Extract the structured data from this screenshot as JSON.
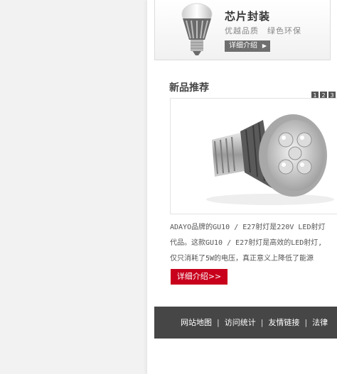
{
  "banner": {
    "title": "芯片封装",
    "subtitle": "优越品质　绿色环保",
    "button_label": "详细介绍",
    "button_arrow": "▶"
  },
  "section": {
    "title": "新品推荐",
    "pages": [
      "1",
      "2",
      "3"
    ]
  },
  "product": {
    "description_lines": [
      "ADAYO品牌的GU10 / E27射灯是220V LED射灯",
      "代品。这款GU10 / E27射灯是高效的LED射灯,",
      "仅只消耗了5W的电压，真正意义上降低了能源"
    ],
    "more_label": "详细介绍>>"
  },
  "footer": {
    "links": [
      "网站地图",
      "访问统计",
      "友情链接",
      "法律"
    ],
    "separator": "|"
  },
  "colors": {
    "accent_red": "#c8001c",
    "footer_bg": "#464646",
    "banner_button": "#6f6f6f"
  }
}
